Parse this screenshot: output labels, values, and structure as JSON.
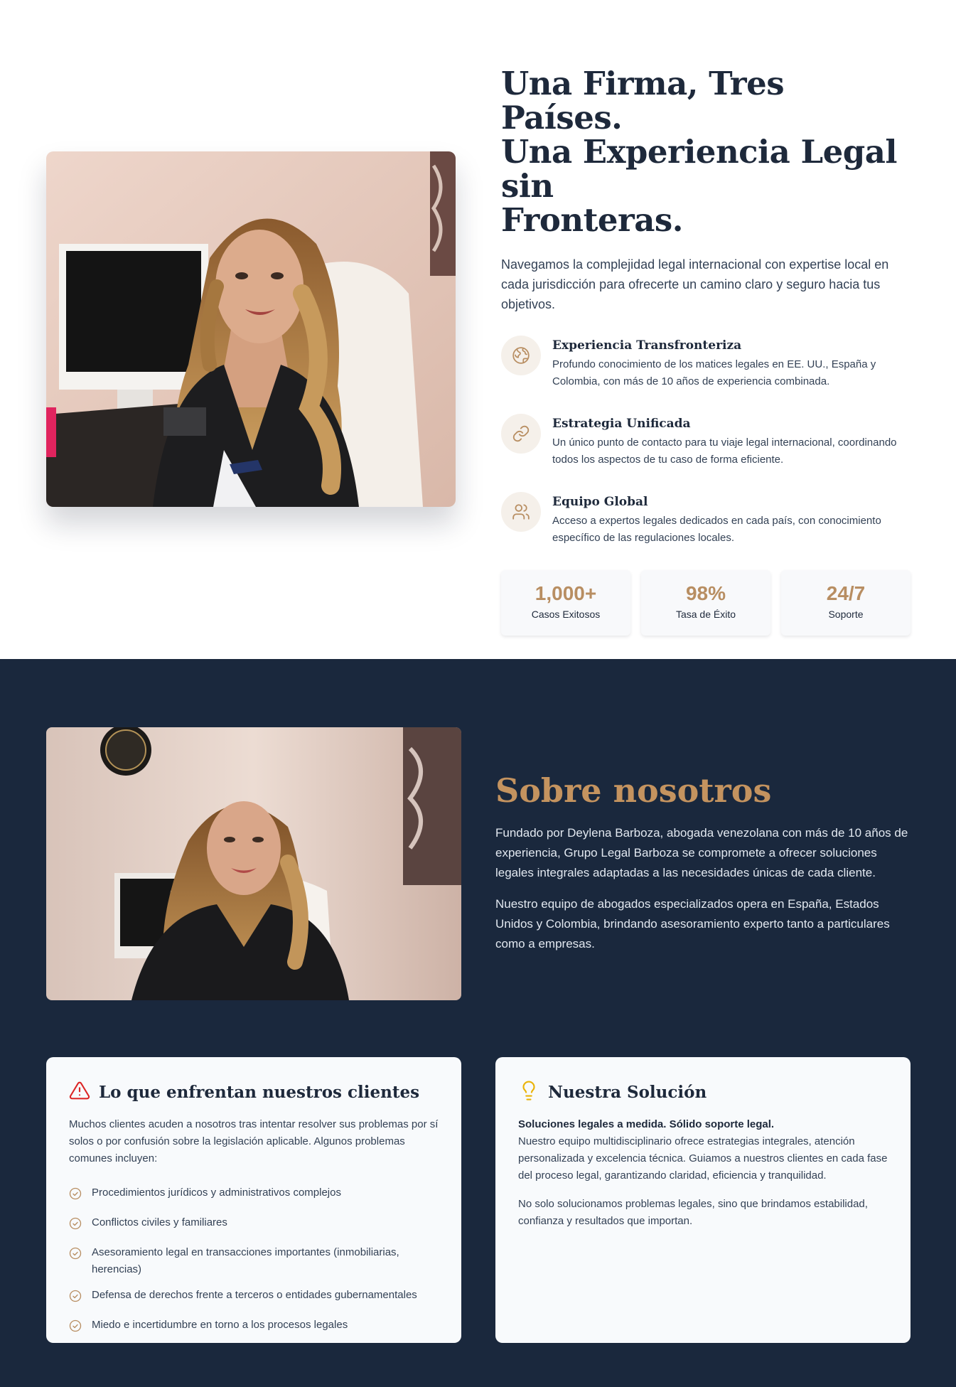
{
  "hero": {
    "title_line1": "Una Firma, Tres Países.",
    "title_line2": "Una Experiencia Legal sin",
    "title_line3": "Fronteras.",
    "lead": "Navegamos la complejidad legal internacional con expertise local en cada jurisdicción para ofrecerte un camino claro y seguro hacia tus objetivos.",
    "features": [
      {
        "icon": "globe-icon",
        "title": "Experiencia Transfronteriza",
        "description": "Profundo conocimiento de los matices legales en EE. UU., España y Colombia, con más de 10 años de experiencia combinada."
      },
      {
        "icon": "link-icon",
        "title": "Estrategia Unificada",
        "description": "Un único punto de contacto para tu viaje legal internacional, coordinando todos los aspectos de tu caso de forma eficiente."
      },
      {
        "icon": "users-icon",
        "title": "Equipo Global",
        "description": "Acceso a expertos legales dedicados en cada país, con conocimiento específico de las regulaciones locales."
      }
    ],
    "stats": [
      {
        "value": "1,000+",
        "label": "Casos Exitosos"
      },
      {
        "value": "98%",
        "label": "Tasa de Éxito"
      },
      {
        "value": "24/7",
        "label": "Soporte"
      }
    ]
  },
  "about": {
    "title": "Sobre nosotros",
    "paragraph1": "Fundado por Deylena Barboza, abogada venezolana con más de 10 años de experiencia, Grupo Legal Barboza se compromete a ofrecer soluciones legales integrales adaptadas a las necesidades únicas de cada cliente.",
    "paragraph2": "Nuestro equipo de abogados especializados opera en España, Estados Unidos y Colombia, brindando asesoramiento experto tanto a particulares como a empresas."
  },
  "problems_card": {
    "title": "Lo que enfrentan nuestros clientes",
    "intro": "Muchos clientes acuden a nosotros tras intentar resolver sus problemas por sí solos o por confusión sobre la legislación aplicable. Algunos problemas comunes incluyen:",
    "items": [
      "Procedimientos jurídicos y administrativos complejos",
      "Conflictos civiles y familiares",
      "Asesoramiento legal en transacciones importantes (inmobiliarias, herencias)",
      "Defensa de derechos frente a terceros o entidades gubernamentales",
      "Miedo e incertidumbre en torno a los procesos legales"
    ]
  },
  "solution_card": {
    "title": "Nuestra Solución",
    "strong": "Soluciones legales a medida. Sólido soporte legal.",
    "paragraph1": "Nuestro equipo multidisciplinario ofrece estrategias integrales, atención personalizada y excelencia técnica. Guiamos a nuestros clientes en cada fase del proceso legal, garantizando claridad, eficiencia y tranquilidad.",
    "paragraph2": "No solo solucionamos problemas legales, sino que brindamos estabilidad, confianza y resultados que importan."
  },
  "colors": {
    "accent_gold": "#b88e62",
    "navy_background": "#1a283d",
    "warning_red": "#dc2626",
    "bulb_yellow": "#eab308"
  }
}
